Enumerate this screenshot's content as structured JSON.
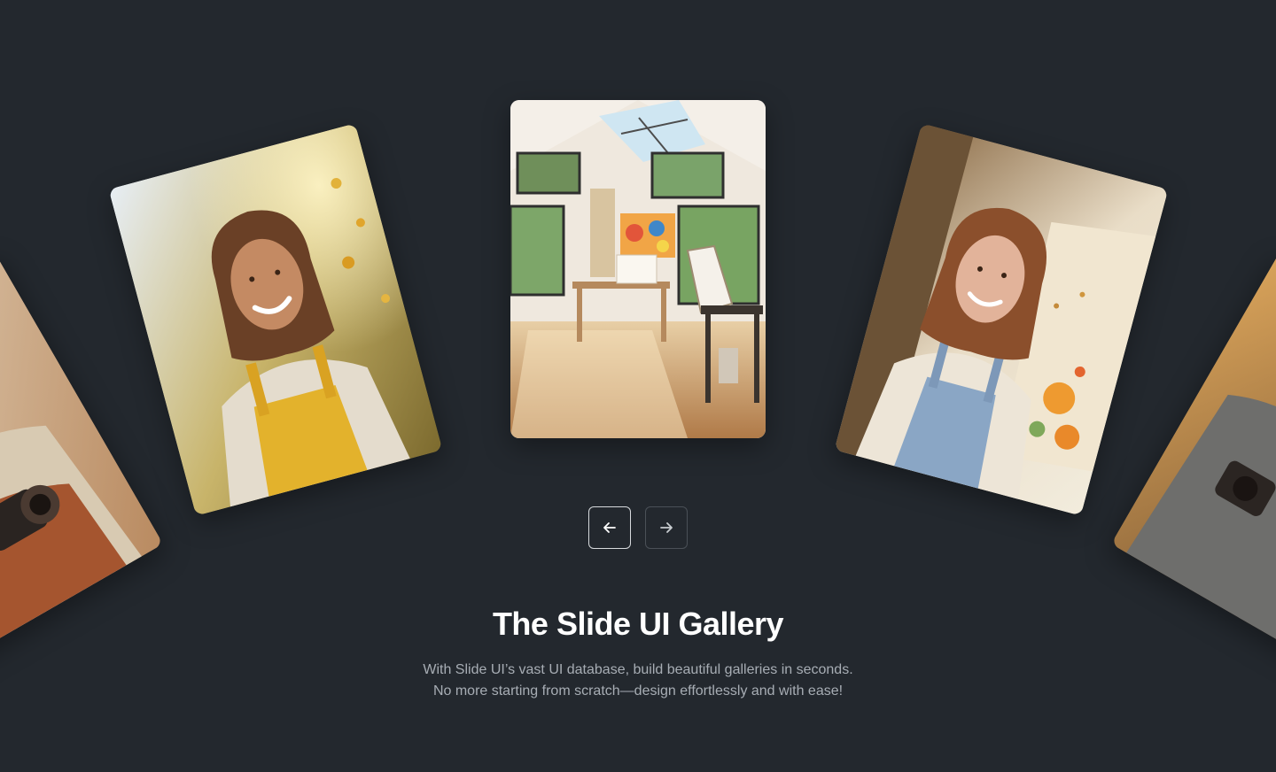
{
  "gallery": {
    "slides": [
      {
        "name": "photographer-with-camera",
        "alt": "slide-far-left"
      },
      {
        "name": "smiling-woman-yellow-overalls",
        "alt": "slide-left"
      },
      {
        "name": "sunlit-art-studio",
        "alt": "slide-center"
      },
      {
        "name": "woman-painting-at-easel",
        "alt": "slide-right"
      },
      {
        "name": "man-with-camera",
        "alt": "slide-far-right"
      }
    ],
    "prev_icon": "arrow-left-icon",
    "next_icon": "arrow-right-icon"
  },
  "hero": {
    "title": "The Slide UI Gallery",
    "subtitle_line1": "With Slide UI’s vast UI database, build beautiful galleries in seconds.",
    "subtitle_line2": "No more starting from scratch—design effortlessly and with ease!"
  },
  "colors": {
    "background": "#23282e",
    "title": "#ffffff",
    "subtitle": "#a7adb4",
    "prev_border": "#d7dadd",
    "next_border": "#4a5057"
  }
}
